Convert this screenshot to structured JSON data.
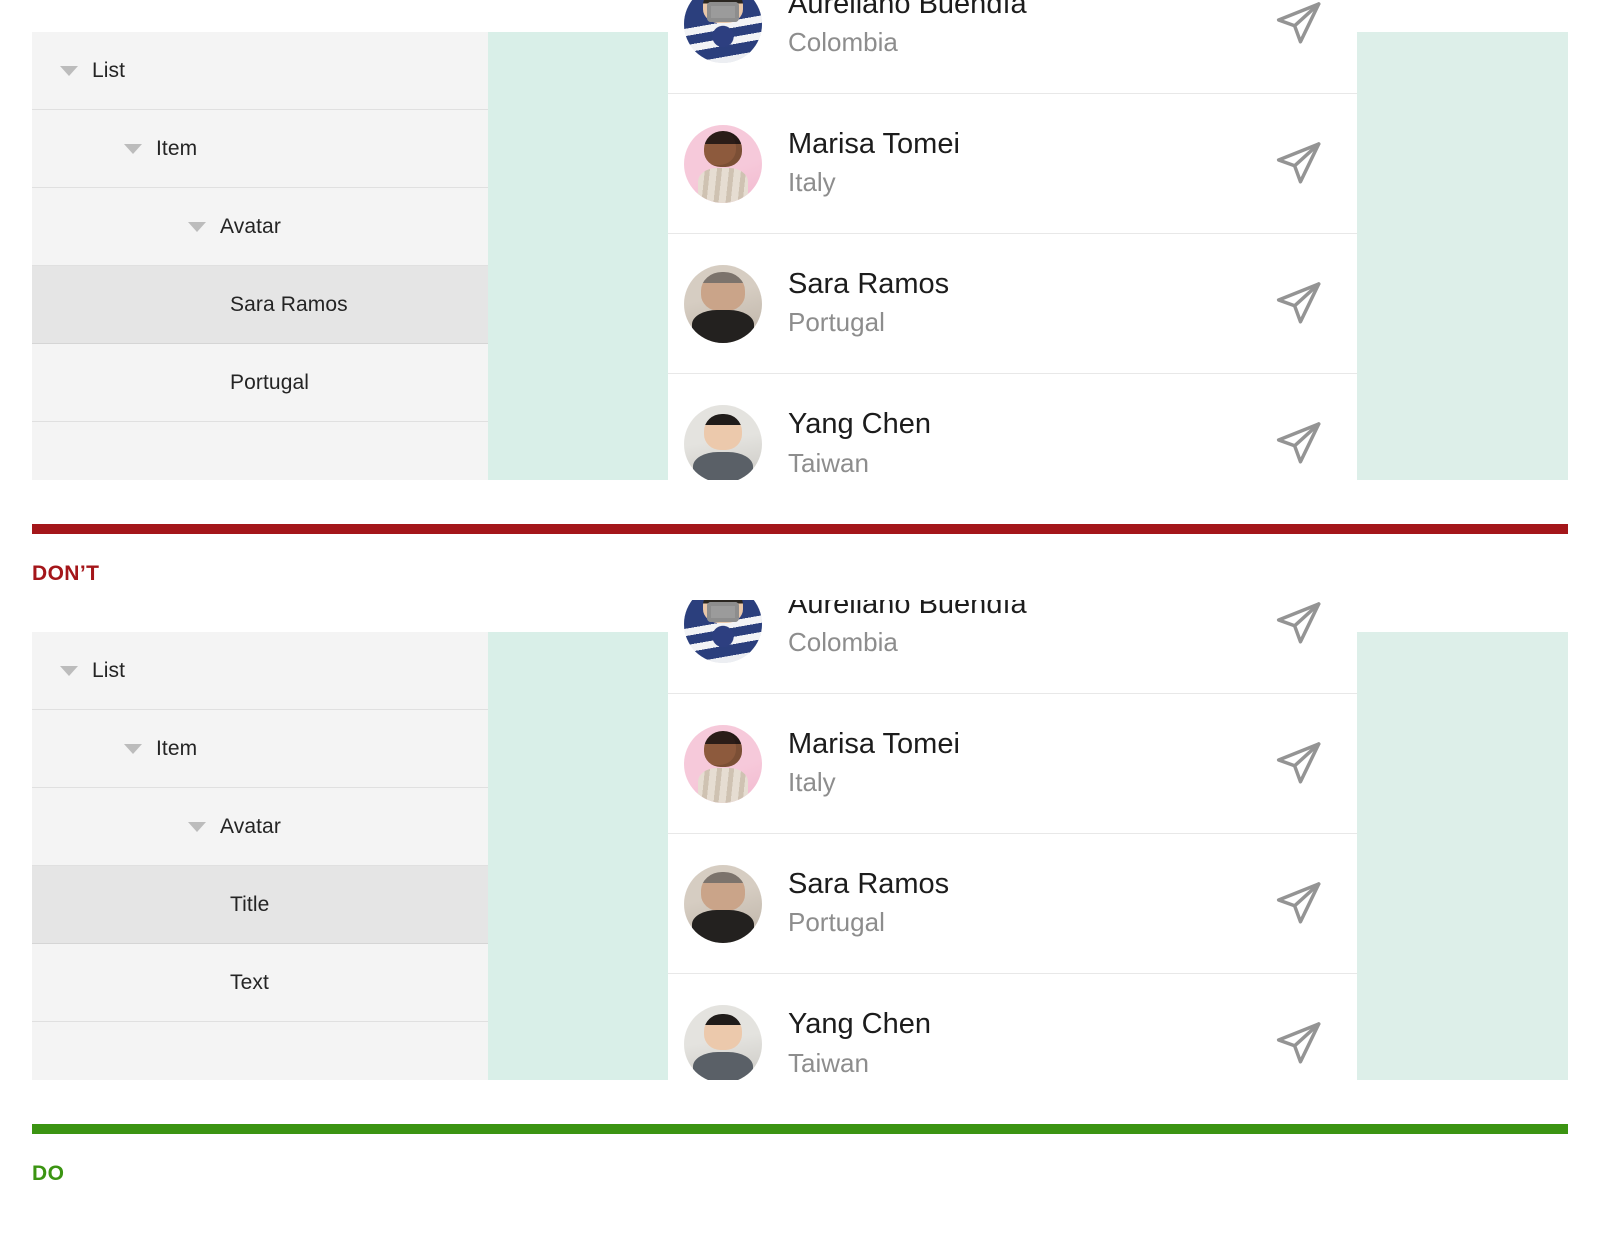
{
  "page": {
    "background": "#ffffff",
    "panel_bg": "#f4f4f4",
    "panel_row_selected_bg": "#e5e5e5",
    "mint_bg": "#d9efe8",
    "dont_color": "#a4161a",
    "do_color": "#3b9412"
  },
  "sections": [
    {
      "id": "dont",
      "verdict": {
        "label": "DON’T",
        "color": "#a4161a"
      },
      "tree": {
        "rows": [
          {
            "label": "List",
            "level": 0,
            "caret": true,
            "selected": false
          },
          {
            "label": "Item",
            "level": 1,
            "caret": true,
            "selected": false
          },
          {
            "label": "Avatar",
            "level": 2,
            "caret": true,
            "selected": false
          },
          {
            "label": "Sara Ramos",
            "level": 3,
            "caret": false,
            "selected": true
          },
          {
            "label": "Portugal",
            "level": 3,
            "caret": false,
            "selected": false
          },
          {
            "label": "",
            "level": 3,
            "caret": false,
            "selected": false
          }
        ]
      },
      "contacts": [
        {
          "name": "Aureliano Buendía",
          "country": "Colombia",
          "avatar": "ph-aureliano",
          "action_icon": "send-icon"
        },
        {
          "name": "Marisa Tomei",
          "country": "Italy",
          "avatar": "ph-marisa",
          "action_icon": "send-icon"
        },
        {
          "name": "Sara Ramos",
          "country": "Portugal",
          "avatar": "ph-sara",
          "action_icon": "send-icon"
        },
        {
          "name": "Yang Chen",
          "country": "Taiwan",
          "avatar": "ph-yang",
          "action_icon": "send-icon"
        }
      ]
    },
    {
      "id": "do",
      "verdict": {
        "label": "DO",
        "color": "#3b9412"
      },
      "tree": {
        "rows": [
          {
            "label": "List",
            "level": 0,
            "caret": true,
            "selected": false
          },
          {
            "label": "Item",
            "level": 1,
            "caret": true,
            "selected": false
          },
          {
            "label": "Avatar",
            "level": 2,
            "caret": true,
            "selected": false
          },
          {
            "label": "Title",
            "level": 3,
            "caret": false,
            "selected": true
          },
          {
            "label": "Text",
            "level": 3,
            "caret": false,
            "selected": false
          },
          {
            "label": "",
            "level": 3,
            "caret": false,
            "selected": false
          }
        ]
      },
      "contacts": [
        {
          "name": "Aureliano Buendía",
          "country": "Colombia",
          "avatar": "ph-aureliano",
          "action_icon": "send-icon"
        },
        {
          "name": "Marisa Tomei",
          "country": "Italy",
          "avatar": "ph-marisa",
          "action_icon": "send-icon"
        },
        {
          "name": "Sara Ramos",
          "country": "Portugal",
          "avatar": "ph-sara",
          "action_icon": "send-icon"
        },
        {
          "name": "Yang Chen",
          "country": "Taiwan",
          "avatar": "ph-yang",
          "action_icon": "send-icon"
        }
      ]
    }
  ]
}
